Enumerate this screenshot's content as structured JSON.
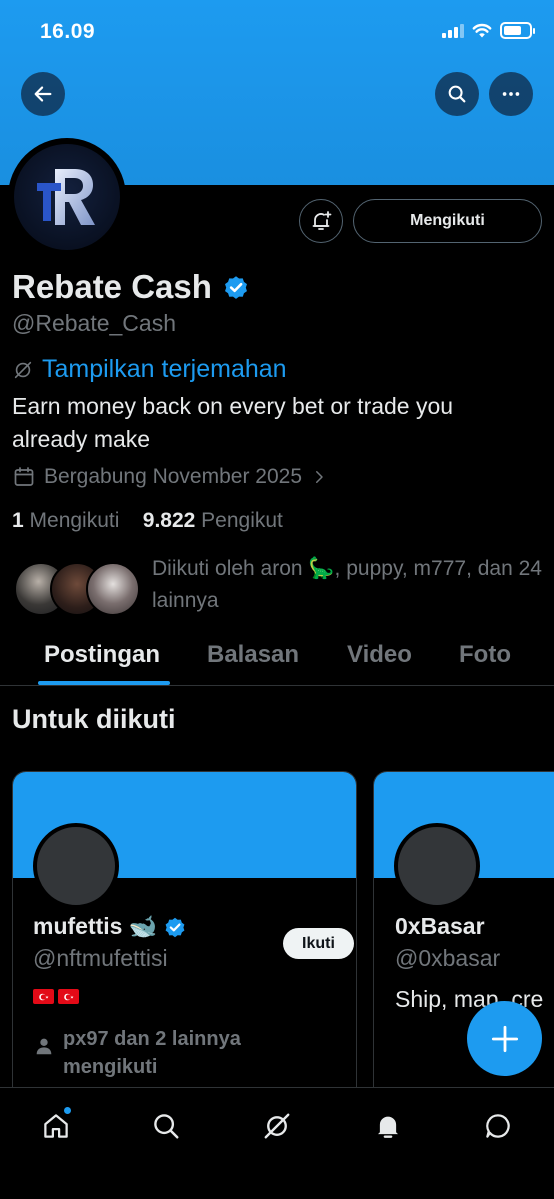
{
  "status_bar": {
    "time": "16.09"
  },
  "profile": {
    "name": "Rebate Cash",
    "handle": "@Rebate_Cash",
    "translate_label": "Tampilkan terjemahan",
    "bio": "Earn money back on every bet or trade you already make",
    "joined": "Bergabung November 2025",
    "following_count": "1",
    "following_label": "Mengikuti",
    "followers_count": "9.822",
    "followers_label": "Pengikut",
    "followed_by": "Diikuti oleh aron 🦕, puppy, m777, dan 24 lainnya",
    "follow_button_label": "Mengikuti"
  },
  "tabs": [
    {
      "label": "Postingan",
      "active": true
    },
    {
      "label": "Balasan",
      "active": false
    },
    {
      "label": "Video",
      "active": false
    },
    {
      "label": "Foto",
      "active": false
    }
  ],
  "suggestions": {
    "title": "Untuk diikuti",
    "cards": [
      {
        "name": "mufettis 🐋",
        "handle": "@nftmufettisi",
        "verified": true,
        "follow_label": "Ikuti",
        "mutual": "px97 dan 2 lainnya mengikuti"
      },
      {
        "name": "0xBasar",
        "handle": "@0xbasar",
        "bio": "Ship, map, cre"
      }
    ]
  },
  "bottom_nav": [
    "home-icon",
    "search-icon",
    "grok-icon",
    "notifications-icon",
    "messages-icon"
  ],
  "colors": {
    "accent": "#1d9bf0",
    "background": "#000000",
    "muted": "#71767b"
  }
}
